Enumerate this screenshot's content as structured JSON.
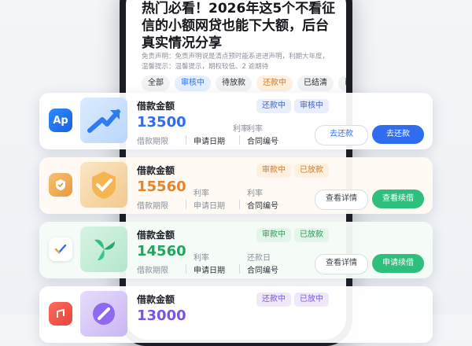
{
  "article": {
    "headline": "热门必看！2026年这5个不看征信的小额网贷也能下大额，后台真实情况分享",
    "notice_lines": [
      "免责声明：免责声明说是清点预时能系进进声明，利期大年度，",
      "温馨提示：温馨提示，期权较低、2 逾期待"
    ]
  },
  "filters": [
    {
      "label": "全部",
      "style": "plain"
    },
    {
      "label": "审核中",
      "style": "on"
    },
    {
      "label": "待放款",
      "style": "plain"
    },
    {
      "label": "还款中",
      "style": "orange"
    },
    {
      "label": "已结清",
      "style": "plain"
    },
    {
      "label": "已逾",
      "style": "plain"
    }
  ],
  "cards": [
    {
      "icon_text": "Ap",
      "icon": "app-icon-blue",
      "art": "arrow-art",
      "title": "借款金额",
      "amount": "13500",
      "amount_color": "#2f6cf0",
      "row1": [
        "",
        "利率",
        "利率"
      ],
      "row2": [
        "借款期限",
        "申请日期",
        "合同编号"
      ],
      "badges": [
        {
          "text": "还款中",
          "bg": "#e8eefb",
          "fg": "#3c64c8"
        },
        {
          "text": "审核中",
          "bg": "#e8eefb",
          "fg": "#3c64c8"
        }
      ],
      "buttons": [
        "去还款",
        "去还款"
      ],
      "btn_solid_color": "#2f6cf0",
      "ghost_dark": false
    },
    {
      "icon_text": "",
      "icon": "app-icon-orange",
      "art": "check-shield-art",
      "title": "借款金额",
      "amount": "15560",
      "amount_color": "#e4862e",
      "row1": [
        "",
        "利率",
        "利率"
      ],
      "row2": [
        "借款期限",
        "申请日期",
        "合同编号"
      ],
      "badges": [
        {
          "text": "审款中",
          "bg": "#fff0e0",
          "fg": "#d0782a"
        },
        {
          "text": "已放款",
          "bg": "#fff0e0",
          "fg": "#d0782a"
        }
      ],
      "buttons": [
        "查看详情",
        "查看续借"
      ],
      "btn_solid_color": "#2fbf7d",
      "ghost_dark": true
    },
    {
      "icon_text": "",
      "icon": "app-icon-white-check",
      "art": "leaf-art",
      "title": "借款金额",
      "amount": "14560",
      "amount_color": "#1fa65f",
      "row1": [
        "",
        "利率",
        "还款日"
      ],
      "row2": [
        "借款期限",
        "申请日期",
        "合同编号"
      ],
      "badges": [
        {
          "text": "审款中",
          "bg": "#e4f6ea",
          "fg": "#2a9a5a"
        },
        {
          "text": "已放款",
          "bg": "#e4f6ea",
          "fg": "#2a9a5a"
        }
      ],
      "buttons": [
        "查看详情",
        "申请续借"
      ],
      "btn_solid_color": "#2fbf7d",
      "ghost_dark": true
    },
    {
      "icon_text": "",
      "icon": "app-icon-red",
      "art": "circle-art",
      "title": "借款金额",
      "amount": "13000",
      "amount_color": "#7b55e0",
      "row1": [
        "",
        "",
        ""
      ],
      "row2": [
        "",
        "",
        ""
      ],
      "badges": [
        {
          "text": "还款中",
          "bg": "#efe8fb",
          "fg": "#7b55e0"
        },
        {
          "text": "已放中",
          "bg": "#efe8fb",
          "fg": "#7b55e0"
        }
      ],
      "buttons": [
        "",
        ""
      ],
      "btn_solid_color": "#7b55e0",
      "ghost_dark": true
    }
  ]
}
